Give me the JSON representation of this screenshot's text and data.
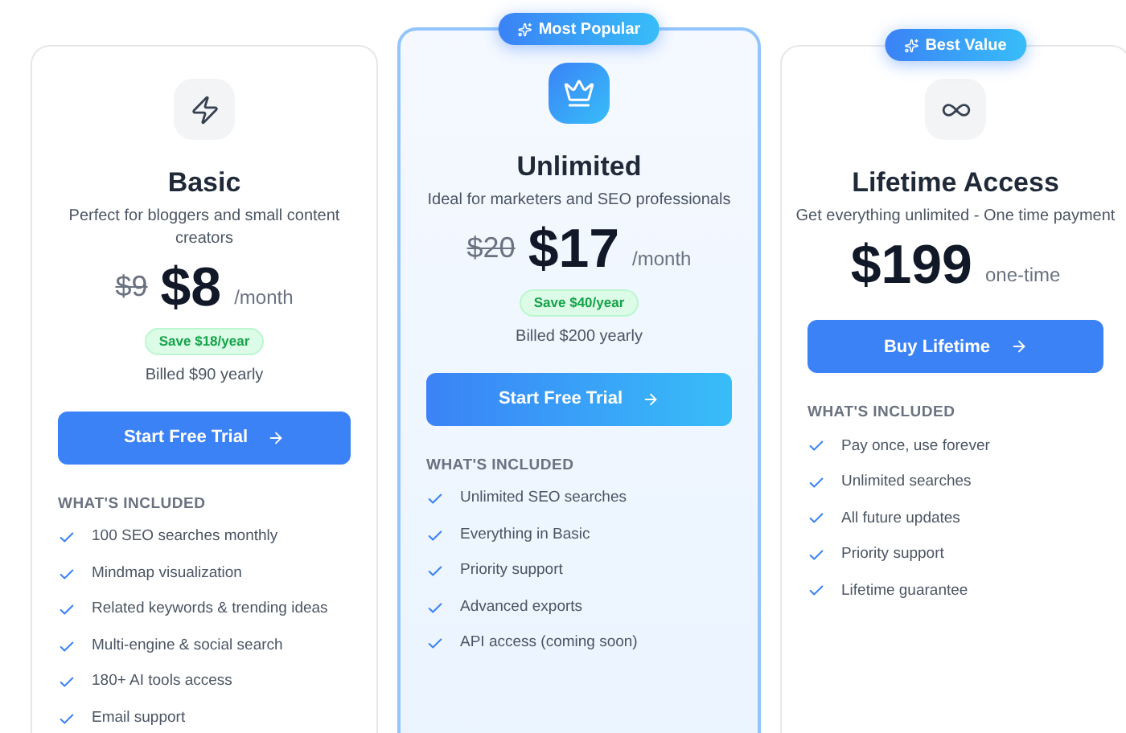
{
  "plans": [
    {
      "kind": "bolt",
      "featured": false,
      "name": "Basic",
      "description": "Perfect for bloggers and small content creators",
      "old_price": "$9",
      "price": "$8",
      "period": "/month",
      "savings": "Save $18/year",
      "billing": "Billed $90 yearly",
      "cta": "Start Free Trial",
      "features_heading": "WHAT'S INCLUDED",
      "features": [
        "100 SEO searches monthly",
        "Mindmap visualization",
        "Related keywords & trending ideas",
        "Multi-engine & social search",
        "180+ AI tools access",
        "Email support"
      ]
    },
    {
      "badge": "Most Popular",
      "kind": "crown",
      "featured": true,
      "name": "Unlimited",
      "description": "Ideal for marketers and SEO professionals",
      "old_price": "$20",
      "price": "$17",
      "period": "/month",
      "savings": "Save $40/year",
      "billing": "Billed $200 yearly",
      "cta": "Start Free Trial",
      "features_heading": "WHAT'S INCLUDED",
      "features": [
        "Unlimited SEO searches",
        "Everything in Basic",
        "Priority support",
        "Advanced exports",
        "API access (coming soon)"
      ]
    },
    {
      "badge": "Best Value",
      "kind": "infinity",
      "featured": false,
      "name": "Lifetime Access",
      "description": "Get everything unlimited - One time payment",
      "price": "$199",
      "period": "one-time",
      "cta": "Buy Lifetime",
      "features_heading": "WHAT'S INCLUDED",
      "features": [
        "Pay once, use forever",
        "Unlimited searches",
        "All future updates",
        "Priority support",
        "Lifetime guarantee"
      ]
    }
  ]
}
